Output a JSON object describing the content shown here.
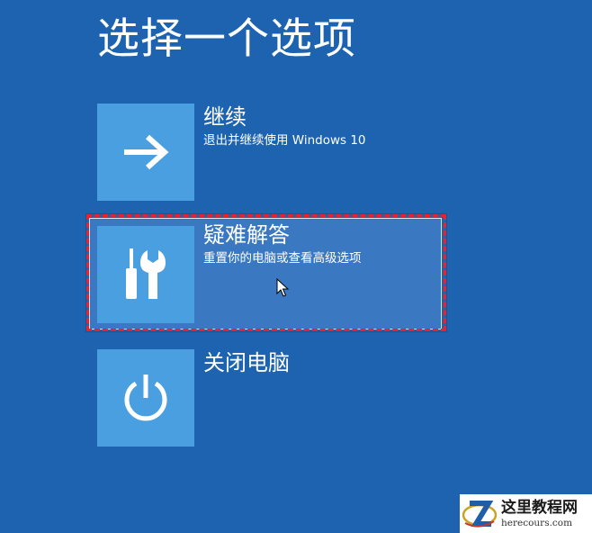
{
  "title": "选择一个选项",
  "options": [
    {
      "name": "继续",
      "description": "退出并继续使用 Windows 10",
      "icon": "arrow-right-icon",
      "selected": false
    },
    {
      "name": "疑难解答",
      "description": "重置你的电脑或查看高级选项",
      "icon": "tools-icon",
      "selected": true
    },
    {
      "name": "关闭电脑",
      "description": "",
      "icon": "power-icon",
      "selected": false
    }
  ],
  "watermark": {
    "name": "这里教程网",
    "url": "herecours.com"
  },
  "colors": {
    "background": "#1d63b0",
    "tile": "#4a9fe0",
    "selected_row": "#3a79c2",
    "highlight_dash": "#e8222e"
  }
}
